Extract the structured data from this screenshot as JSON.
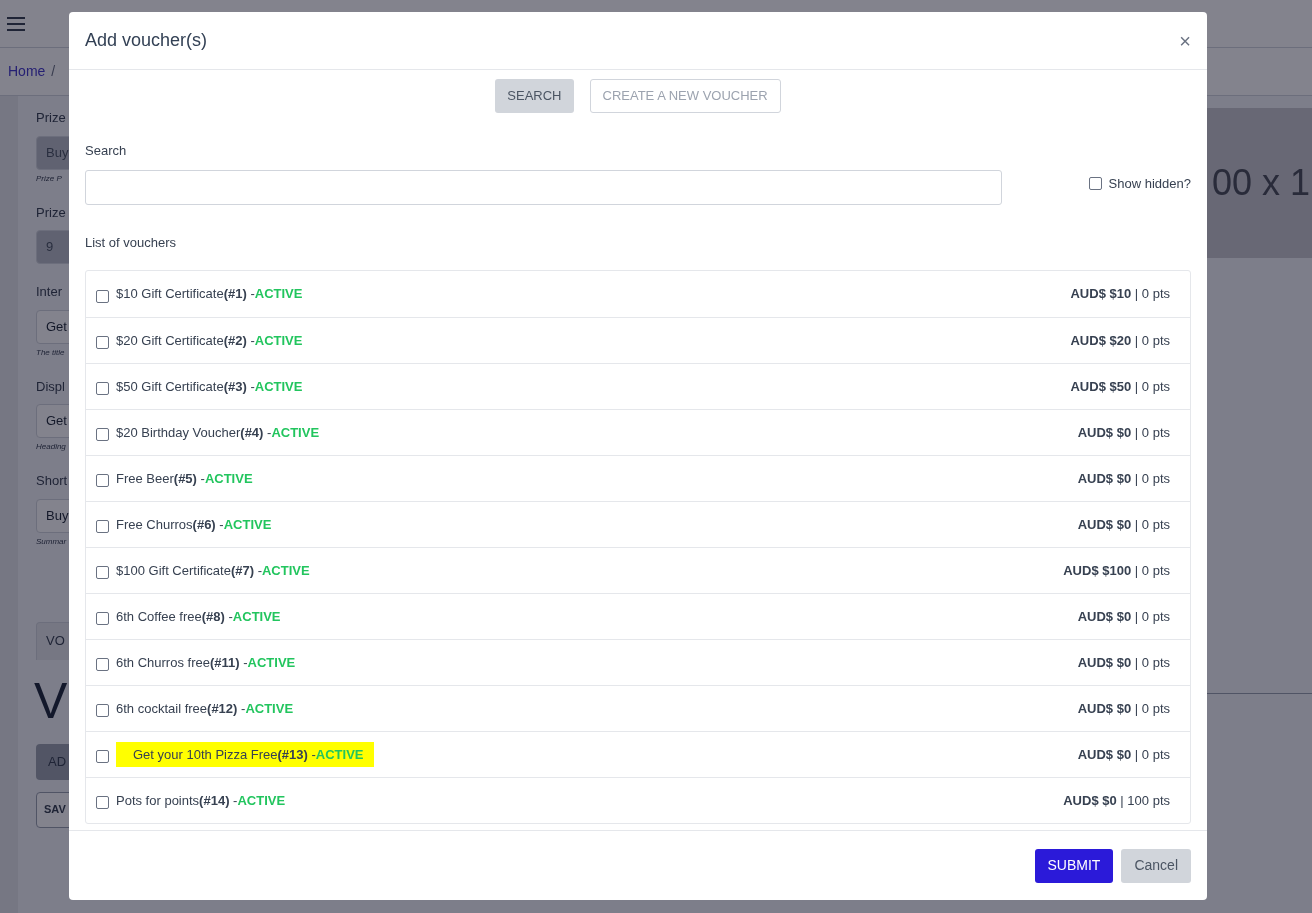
{
  "page": {
    "breadcrumb": [
      "Home",
      "/"
    ],
    "fields": [
      {
        "label": "Prize",
        "value": "Buy",
        "hint": "Prize P",
        "disabled": true
      },
      {
        "label": "Prize",
        "value": "9",
        "disabled": true
      },
      {
        "label": "Inter",
        "value": "Get",
        "hint": "The title",
        "disabled": false
      },
      {
        "label": "Displ",
        "value": "Get",
        "hint": "Heading",
        "disabled": false
      },
      {
        "label": "Short",
        "value": "Buy",
        "hint": "Summar",
        "disabled": false
      }
    ],
    "tab": "VO",
    "heading": "V",
    "buttons": [
      "AD",
      "SAV"
    ],
    "image_text": "00 x 1"
  },
  "modal": {
    "title": "Add voucher(s)",
    "close": "×",
    "actions": [
      {
        "label": "SEARCH",
        "disabled": false
      },
      {
        "label": "CREATE A NEW VOUCHER",
        "disabled": true
      }
    ],
    "search": {
      "label": "Search"
    },
    "show_hidden": {
      "label": "Show hidden?",
      "checked": false
    },
    "list_label": "List of vouchers",
    "vouchers": [
      {
        "name": "$10 Gift Certificate",
        "id": "(#1)",
        "status": "-ACTIVE",
        "price": "AUD$ $10",
        "points": "0 pts",
        "checked": false,
        "highlighted": false
      },
      {
        "name": "$20 Gift Certificate",
        "id": "(#2)",
        "status": "-ACTIVE",
        "price": "AUD$ $20",
        "points": "0 pts",
        "checked": false,
        "highlighted": false
      },
      {
        "name": "$50 Gift Certificate",
        "id": "(#3)",
        "status": "-ACTIVE",
        "price": "AUD$ $50",
        "points": "0 pts",
        "checked": false,
        "highlighted": false
      },
      {
        "name": "$20 Birthday Voucher",
        "id": "(#4)",
        "status": "-ACTIVE",
        "price": "AUD$ $0",
        "points": "0 pts",
        "checked": false,
        "highlighted": false
      },
      {
        "name": "Free Beer",
        "id": "(#5)",
        "status": "-ACTIVE",
        "price": "AUD$ $0",
        "points": "0 pts",
        "checked": false,
        "highlighted": false
      },
      {
        "name": "Free Churros",
        "id": "(#6)",
        "status": "-ACTIVE",
        "price": "AUD$ $0",
        "points": "0 pts",
        "checked": false,
        "highlighted": false
      },
      {
        "name": "$100 Gift Certificate",
        "id": "(#7)",
        "status": "-ACTIVE",
        "price": "AUD$ $100",
        "points": "0 pts",
        "checked": false,
        "highlighted": false
      },
      {
        "name": "6th Coffee free",
        "id": "(#8)",
        "status": "-ACTIVE",
        "price": "AUD$ $0",
        "points": "0 pts",
        "checked": false,
        "highlighted": false
      },
      {
        "name": "6th Churros free",
        "id": "(#11)",
        "status": "-ACTIVE",
        "price": "AUD$ $0",
        "points": "0 pts",
        "checked": false,
        "highlighted": false
      },
      {
        "name": "6th cocktail free",
        "id": "(#12)",
        "status": "-ACTIVE",
        "price": "AUD$ $0",
        "points": "0 pts",
        "checked": false,
        "highlighted": false
      },
      {
        "name": "Get your 10th Pizza Free",
        "id": "(#13)",
        "status": "-ACTIVE",
        "price": "AUD$ $0",
        "points": "0 pts",
        "checked": false,
        "highlighted": true
      },
      {
        "name": "Pots for points",
        "id": "(#14)",
        "status": "-ACTIVE",
        "price": "AUD$ $0",
        "points": "100 pts",
        "checked": false,
        "highlighted": false
      }
    ],
    "separator": "|",
    "footer": [
      {
        "label": "SUBMIT",
        "kind": "primary"
      },
      {
        "label": "Cancel",
        "kind": "secondary"
      }
    ]
  }
}
